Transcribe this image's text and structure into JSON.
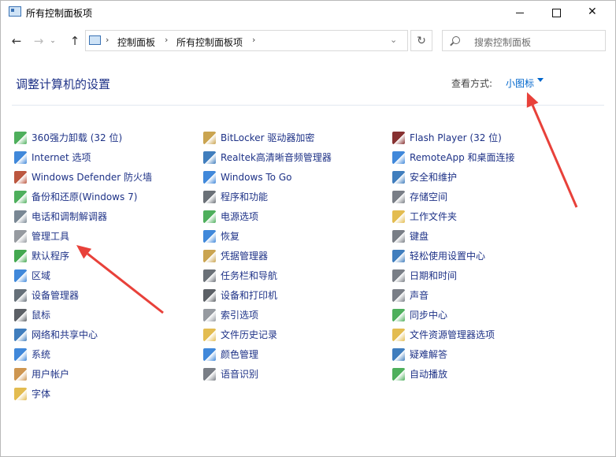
{
  "window": {
    "title": "所有控制面板项"
  },
  "address": {
    "crumbs": [
      "控制面板",
      "所有控制面板项"
    ],
    "search_placeholder": "搜索控制面板"
  },
  "content": {
    "heading": "调整计算机的设置",
    "view_label": "查看方式:",
    "view_value": "小图标"
  },
  "columns": [
    [
      {
        "label": "360强力卸载 (32 位)",
        "icon": "uninstall-icon",
        "color": "#3aa64a"
      },
      {
        "label": "Internet 选项",
        "icon": "internet-icon",
        "color": "#2b7bd6"
      },
      {
        "label": "Windows Defender 防火墙",
        "icon": "firewall-icon",
        "color": "#b5442a"
      },
      {
        "label": "备份和还原(Windows 7)",
        "icon": "backup-icon",
        "color": "#3aa64a"
      },
      {
        "label": "电话和调制解调器",
        "icon": "phone-icon",
        "color": "#6a7a88"
      },
      {
        "label": "管理工具",
        "icon": "admin-tools-icon",
        "color": "#8a8f96"
      },
      {
        "label": "默认程序",
        "icon": "default-programs-icon",
        "color": "#2e9e3c"
      },
      {
        "label": "区域",
        "icon": "region-icon",
        "color": "#2b7bd6"
      },
      {
        "label": "设备管理器",
        "icon": "device-manager-icon",
        "color": "#55606a"
      },
      {
        "label": "鼠标",
        "icon": "mouse-icon",
        "color": "#4a4f55"
      },
      {
        "label": "网络和共享中心",
        "icon": "network-icon",
        "color": "#2b6fb6"
      },
      {
        "label": "系统",
        "icon": "system-icon",
        "color": "#2b7bd6"
      },
      {
        "label": "用户帐户",
        "icon": "users-icon",
        "color": "#c88a3c"
      },
      {
        "label": "字体",
        "icon": "fonts-icon",
        "color": "#e0b43c"
      }
    ],
    [
      {
        "label": "BitLocker 驱动器加密",
        "icon": "bitlocker-icon",
        "color": "#c49a3c"
      },
      {
        "label": "Realtek高清晰音频管理器",
        "icon": "realtek-icon",
        "color": "#2b6fb6"
      },
      {
        "label": "Windows To Go",
        "icon": "windows-to-go-icon",
        "color": "#2b7bd6"
      },
      {
        "label": "程序和功能",
        "icon": "programs-icon",
        "color": "#5a6068"
      },
      {
        "label": "电源选项",
        "icon": "power-icon",
        "color": "#3aa64a"
      },
      {
        "label": "恢复",
        "icon": "recovery-icon",
        "color": "#2b7bd6"
      },
      {
        "label": "凭据管理器",
        "icon": "credential-icon",
        "color": "#c49a3c"
      },
      {
        "label": "任务栏和导航",
        "icon": "taskbar-icon",
        "color": "#5a6068"
      },
      {
        "label": "设备和打印机",
        "icon": "printer-icon",
        "color": "#4a4f55"
      },
      {
        "label": "索引选项",
        "icon": "indexing-icon",
        "color": "#8a8f96"
      },
      {
        "label": "文件历史记录",
        "icon": "file-history-icon",
        "color": "#e0b43c"
      },
      {
        "label": "颜色管理",
        "icon": "color-management-icon",
        "color": "#2b7bd6"
      },
      {
        "label": "语音识别",
        "icon": "microphone-icon",
        "color": "#6a7078"
      }
    ],
    [
      {
        "label": "Flash Player (32 位)",
        "icon": "flash-icon",
        "color": "#7a1a1a"
      },
      {
        "label": "RemoteApp 和桌面连接",
        "icon": "remoteapp-icon",
        "color": "#2b7bd6"
      },
      {
        "label": "安全和维护",
        "icon": "flag-icon",
        "color": "#2b6fb6"
      },
      {
        "label": "存储空间",
        "icon": "storage-icon",
        "color": "#6a7078"
      },
      {
        "label": "工作文件夹",
        "icon": "work-folders-icon",
        "color": "#e0b43c"
      },
      {
        "label": "键盘",
        "icon": "keyboard-icon",
        "color": "#6a7078"
      },
      {
        "label": "轻松使用设置中心",
        "icon": "ease-of-access-icon",
        "color": "#2b6fb6"
      },
      {
        "label": "日期和时间",
        "icon": "clock-icon",
        "color": "#6a7078"
      },
      {
        "label": "声音",
        "icon": "speaker-icon",
        "color": "#6a7078"
      },
      {
        "label": "同步中心",
        "icon": "sync-icon",
        "color": "#3aa64a"
      },
      {
        "label": "文件资源管理器选项",
        "icon": "folder-options-icon",
        "color": "#e0b43c"
      },
      {
        "label": "疑难解答",
        "icon": "troubleshoot-icon",
        "color": "#2b6fb6"
      },
      {
        "label": "自动播放",
        "icon": "autoplay-icon",
        "color": "#3aa64a"
      }
    ]
  ],
  "annotation_color": "#e8413a"
}
